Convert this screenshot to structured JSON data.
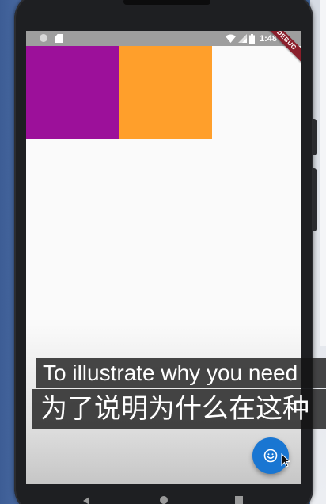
{
  "status_bar": {
    "time": "1:48",
    "icons": [
      "circle-indicator-icon",
      "sd-card-icon",
      "wifi-icon",
      "cell-signal-icon",
      "battery-icon"
    ]
  },
  "debug_banner": {
    "label": "DEBUG",
    "color": "#8a1f2b"
  },
  "content": {
    "boxes": [
      {
        "name": "purple-box",
        "color": "#9c109a"
      },
      {
        "name": "orange-box",
        "color": "#ff9f2b"
      }
    ]
  },
  "fab": {
    "icon": "smiley-face-icon",
    "color": "#1976d2"
  },
  "nav_bar": {
    "icons": [
      "back-triangle-icon",
      "home-circle-icon",
      "recents-square-icon"
    ]
  },
  "subtitles": {
    "english": "To illustrate why you need",
    "chinese": "为了说明为什么在这种"
  }
}
